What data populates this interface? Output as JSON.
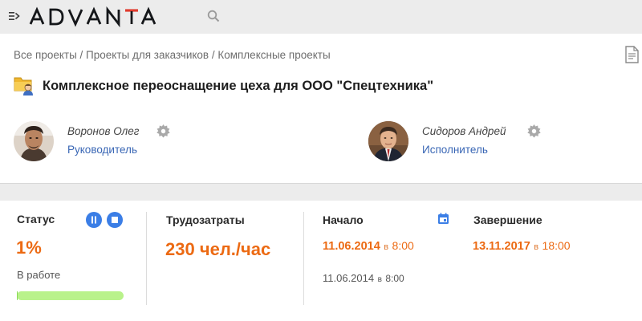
{
  "app": {
    "logo_text": "ADVANTA",
    "menu_icon": "menu-collapse-icon",
    "search_icon": "search-icon"
  },
  "breadcrumb": "Все проекты / Проекты для заказчиков / Комплексные проекты",
  "project": {
    "title": "Комплексное переоснащение цеха для ООО \"Спецтехника\"",
    "icon": "project-folder-icon"
  },
  "people": [
    {
      "name": "Воронов Олег",
      "role": "Руководитель"
    },
    {
      "name": "Сидоров Андрей",
      "role": "Исполнитель"
    }
  ],
  "status": {
    "label": "Статус",
    "percent": "1%",
    "state": "В работе",
    "progress_fraction": 0.01
  },
  "effort": {
    "label": "Трудозатраты",
    "value": "230 чел./час"
  },
  "start": {
    "label": "Начало",
    "planned_date": "11.06.2014",
    "planned_sep": "в",
    "planned_time": "8:00",
    "actual_date": "11.06.2014",
    "actual_sep": "в",
    "actual_time": "8:00"
  },
  "end": {
    "label": "Завершение",
    "date": "13.11.2017",
    "sep": "в",
    "time": "18:00"
  },
  "colors": {
    "accent_orange": "#ec6a13",
    "link_blue": "#3a67b5",
    "button_blue": "#3b7ee6",
    "progress_green": "#b9f28b"
  }
}
